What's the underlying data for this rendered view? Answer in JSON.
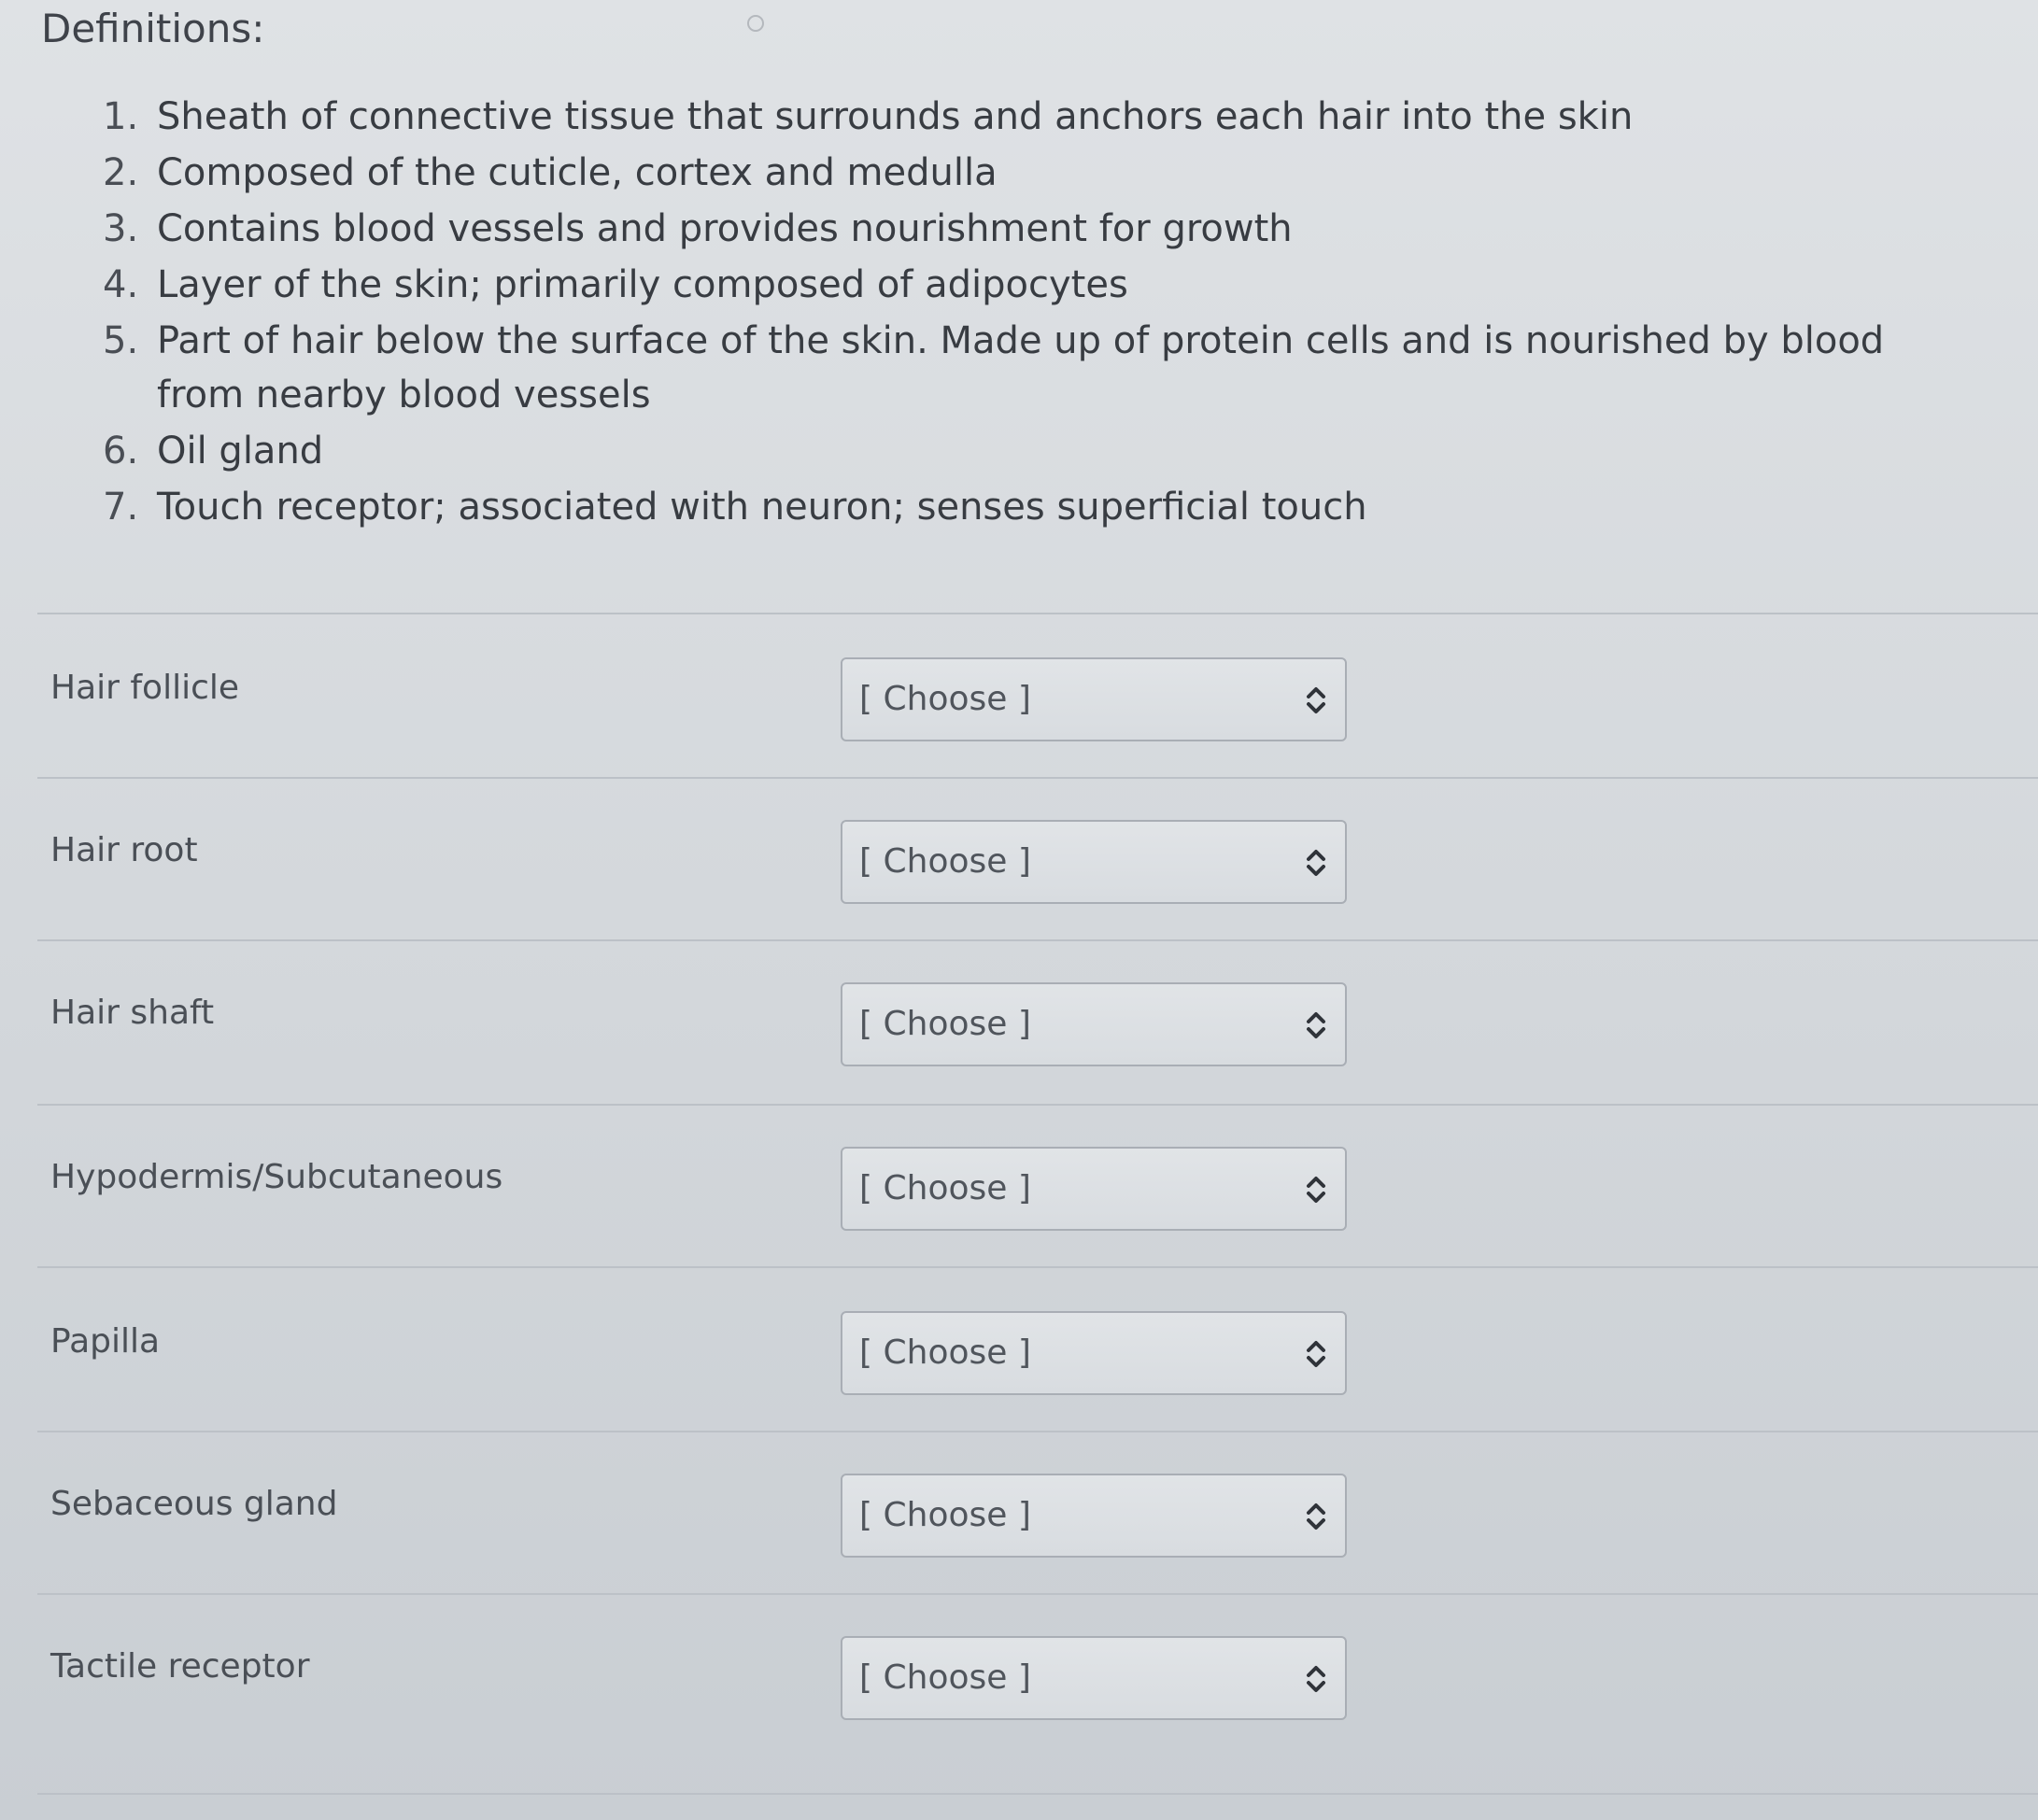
{
  "heading": "Definitions:",
  "definitions": [
    {
      "num": "1.",
      "text": "Sheath of connective tissue that surrounds and anchors each hair into the skin"
    },
    {
      "num": "2.",
      "text": "Composed of the cuticle, cortex and medulla"
    },
    {
      "num": "3.",
      "text": "Contains blood vessels and provides nourishment for growth"
    },
    {
      "num": "4.",
      "text": "Layer of the skin; primarily composed of adipocytes"
    },
    {
      "num": "5.",
      "text": "Part of hair below the surface of the skin. Made up of protein cells and is nourished by blood from nearby blood vessels"
    },
    {
      "num": "6.",
      "text": "Oil gland"
    },
    {
      "num": "7.",
      "text": "Touch receptor; associated with neuron; senses superficial touch"
    }
  ],
  "matches": [
    {
      "label": "Hair follicle",
      "selected": "[ Choose ]"
    },
    {
      "label": "Hair root",
      "selected": "[ Choose ]"
    },
    {
      "label": "Hair shaft",
      "selected": "[ Choose ]"
    },
    {
      "label": "Hypodermis/Subcutaneous",
      "selected": "[ Choose ]"
    },
    {
      "label": "Papilla",
      "selected": "[ Choose ]"
    },
    {
      "label": "Sebaceous gland",
      "selected": "[ Choose ]"
    },
    {
      "label": "Tactile receptor",
      "selected": "[ Choose ]"
    }
  ],
  "icons": {
    "select_indicator": "chevron-up-down-icon"
  },
  "colors": {
    "background": "#d6dadd",
    "text": "#3b3f45",
    "select_border": "#a9aeb5"
  }
}
